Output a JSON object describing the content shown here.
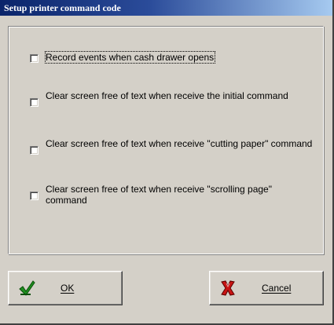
{
  "dialog": {
    "title": "Setup printer command code"
  },
  "options": [
    {
      "label": "Record events when cash drawer opens",
      "checked": false
    },
    {
      "label": "Clear screen free of text when receive the initial command",
      "checked": false
    },
    {
      "label": "Clear screen free of text when receive \"cutting paper\" command",
      "checked": false
    },
    {
      "label": "Clear screen free of text when receive \"scrolling page\" command",
      "checked": false
    }
  ],
  "buttons": {
    "ok": {
      "label": "OK",
      "icon": "green-checkmark-icon"
    },
    "cancel": {
      "label": "Cancel",
      "icon": "red-x-icon"
    }
  },
  "colors": {
    "window": "#d4d0c8",
    "title_bar": "#0a246a",
    "ok_icon": "#1f8f1f",
    "cancel_icon": "#c81414"
  }
}
